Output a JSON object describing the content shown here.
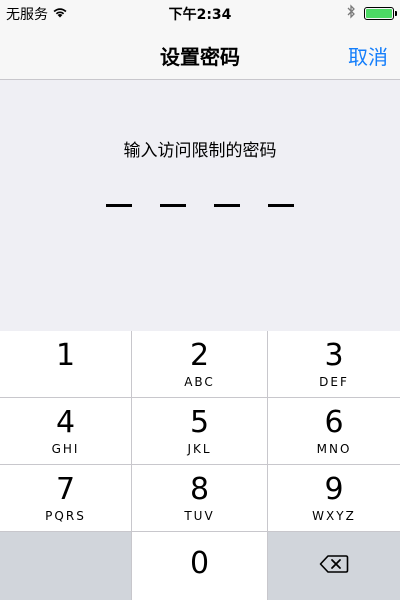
{
  "status": {
    "carrier": "无服务",
    "time": "下午2:34",
    "battery_color": "#4cd964"
  },
  "nav": {
    "title": "设置密码",
    "cancel": "取消"
  },
  "prompt": "输入访问限制的密码",
  "passcode_length": 4,
  "keys": [
    {
      "digit": "1",
      "letters": ""
    },
    {
      "digit": "2",
      "letters": "ABC"
    },
    {
      "digit": "3",
      "letters": "DEF"
    },
    {
      "digit": "4",
      "letters": "GHI"
    },
    {
      "digit": "5",
      "letters": "JKL"
    },
    {
      "digit": "6",
      "letters": "MNO"
    },
    {
      "digit": "7",
      "letters": "PQRS"
    },
    {
      "digit": "8",
      "letters": "TUV"
    },
    {
      "digit": "9",
      "letters": "WXYZ"
    },
    {
      "digit": "0",
      "letters": ""
    }
  ],
  "icons": {
    "wifi": "wifi-icon",
    "bluetooth": "bluetooth-icon",
    "battery": "battery-icon",
    "delete": "delete-backspace-icon"
  },
  "colors": {
    "accent": "#147efb",
    "background": "#efeff4",
    "keypad_dark_key": "#d1d5db"
  }
}
